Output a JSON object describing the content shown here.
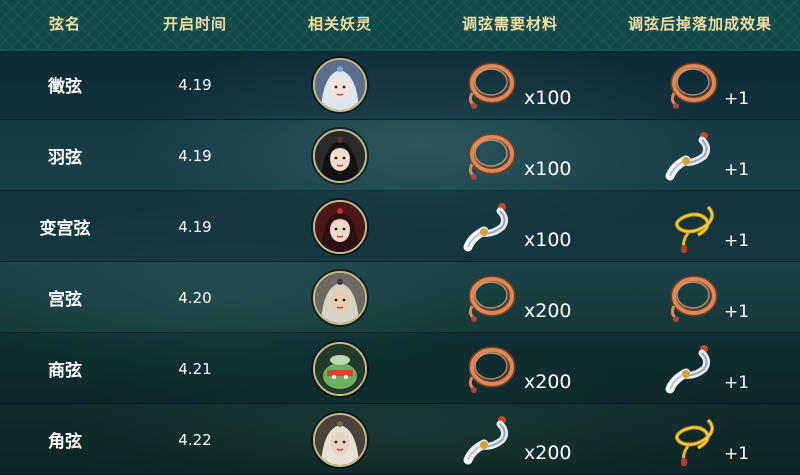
{
  "header": {
    "col_name": "弦名",
    "col_date": "开启时间",
    "col_spirit": "相关妖灵",
    "col_material": "调弦需要材料",
    "col_bonus": "调弦后掉落加成效果"
  },
  "rows": [
    {
      "name": "徵弦",
      "date": "4.19",
      "spirit": "silver-hair-spirit",
      "material": "string-coil-icon",
      "qty": "x100",
      "bonus_item": "string-coil-icon",
      "bonus": "+1"
    },
    {
      "name": "羽弦",
      "date": "4.19",
      "spirit": "black-hair-spirit",
      "material": "string-coil-icon",
      "qty": "x100",
      "bonus_item": "white-tassel-icon",
      "bonus": "+1"
    },
    {
      "name": "变宫弦",
      "date": "4.19",
      "spirit": "red-headdress-spirit",
      "material": "white-tassel-icon",
      "qty": "x100",
      "bonus_item": "gold-cord-icon",
      "bonus": "+1"
    },
    {
      "name": "宫弦",
      "date": "4.20",
      "spirit": "elder-spirit",
      "material": "string-coil-icon",
      "qty": "x200",
      "bonus_item": "string-coil-icon",
      "bonus": "+1"
    },
    {
      "name": "商弦",
      "date": "4.21",
      "spirit": "jade-pot-spirit",
      "material": "string-coil-icon",
      "qty": "x200",
      "bonus_item": "white-tassel-icon",
      "bonus": "+1"
    },
    {
      "name": "角弦",
      "date": "4.22",
      "spirit": "horned-spirit",
      "material": "white-tassel-icon",
      "qty": "x200",
      "bonus_item": "gold-cord-icon",
      "bonus": "+1"
    }
  ],
  "colors": {
    "header_text": "#f1dfa6",
    "header_bg": "#0f4a48",
    "body_text": "#ffffff"
  }
}
